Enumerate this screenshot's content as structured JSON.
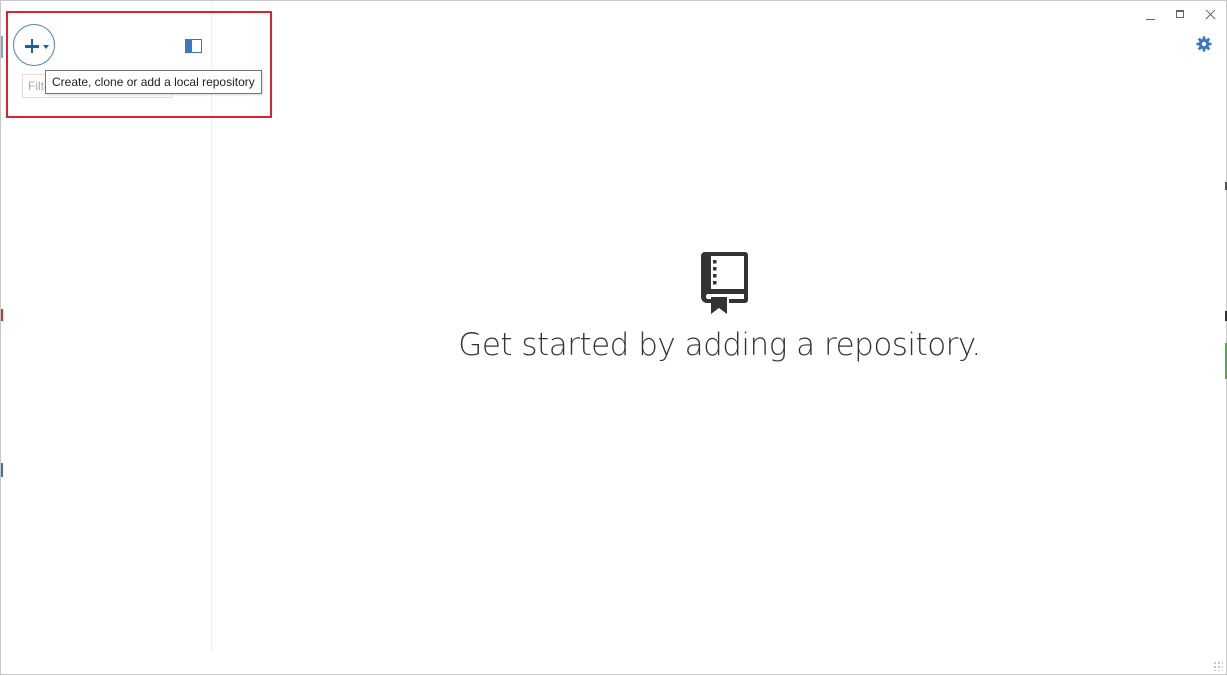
{
  "sidebar": {
    "add_button_tooltip": "Create, clone or add a local repository",
    "filter_placeholder": "Filter repositories",
    "add_button_icon": "plus-icon",
    "collapse_icon": "sidebar-toggle-icon"
  },
  "window_controls": {
    "minimize_icon": "minimize-icon",
    "maximize_icon": "maximize-icon",
    "close_icon": "close-icon",
    "settings_icon": "gear-icon"
  },
  "empty_state": {
    "icon": "repo-book-icon",
    "message": "Get started by adding a repository."
  },
  "colors": {
    "accent": "#1e5ea8",
    "highlight": "#d9232e",
    "text": "#333333"
  }
}
